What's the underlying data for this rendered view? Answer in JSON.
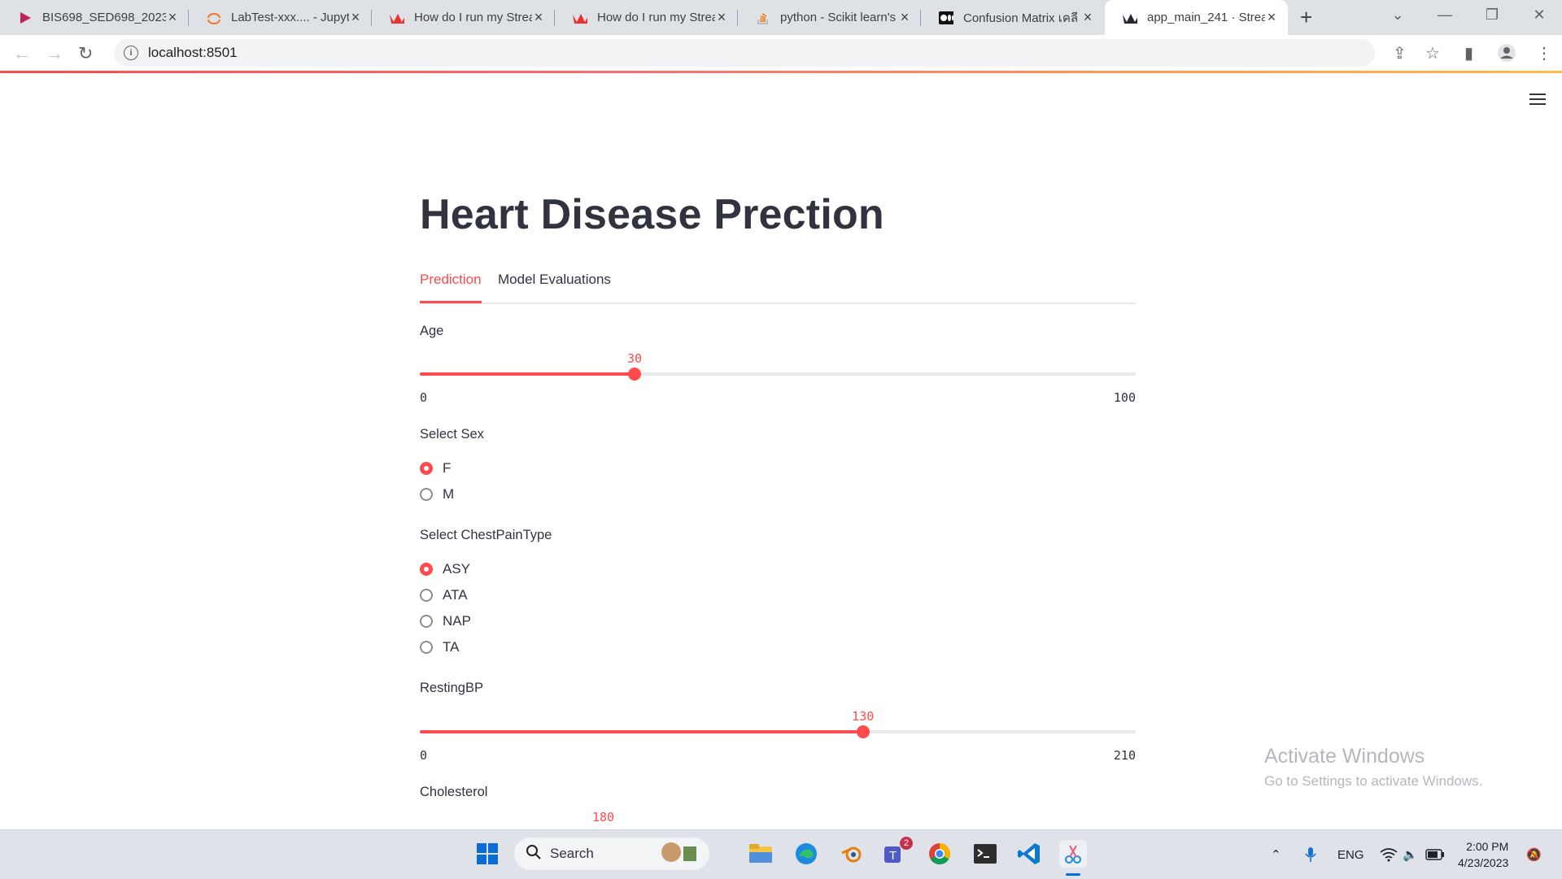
{
  "browser": {
    "tabs": [
      {
        "title": "BIS698_SED698_2023(",
        "icon": "play-icon"
      },
      {
        "title": "LabTest-xxx.... - Jupyte",
        "icon": "jupyter-icon"
      },
      {
        "title": "How do I run my Strea",
        "icon": "streamlit-icon"
      },
      {
        "title": "How do I run my Strea",
        "icon": "streamlit-icon"
      },
      {
        "title": "python - Scikit learn's",
        "icon": "stackoverflow-icon"
      },
      {
        "title": "Confusion Matrix เคลี",
        "icon": "medium-icon"
      },
      {
        "title": "app_main_241 · Strea",
        "icon": "streamlit-icon"
      }
    ],
    "active_tab": 6,
    "url": "localhost:8501"
  },
  "app": {
    "title": "Heart Disease Prection",
    "tabs": [
      "Prediction",
      "Model Evaluations"
    ],
    "active_tab": "Prediction",
    "age": {
      "label": "Age",
      "value": "30",
      "min": "0",
      "max": "100",
      "fraction": 0.3
    },
    "sex": {
      "label": "Select Sex",
      "options": [
        "F",
        "M"
      ],
      "selected": "F"
    },
    "chest": {
      "label": "Select ChestPainType",
      "options": [
        "ASY",
        "ATA",
        "NAP",
        "TA"
      ],
      "selected": "ASY"
    },
    "resting": {
      "label": "RestingBP",
      "value": "130",
      "min": "0",
      "max": "210",
      "fraction": 0.619
    },
    "chol": {
      "label": "Cholesterol",
      "value": "180"
    },
    "accent_color": "#ff4b4b"
  },
  "watermark": {
    "line1": "Activate Windows",
    "line2": "Go to Settings to activate Windows."
  },
  "taskbar": {
    "search_label": "Search",
    "teams_badge": "2",
    "language": "ENG",
    "time": "2:00 PM",
    "date": "4/23/2023"
  }
}
